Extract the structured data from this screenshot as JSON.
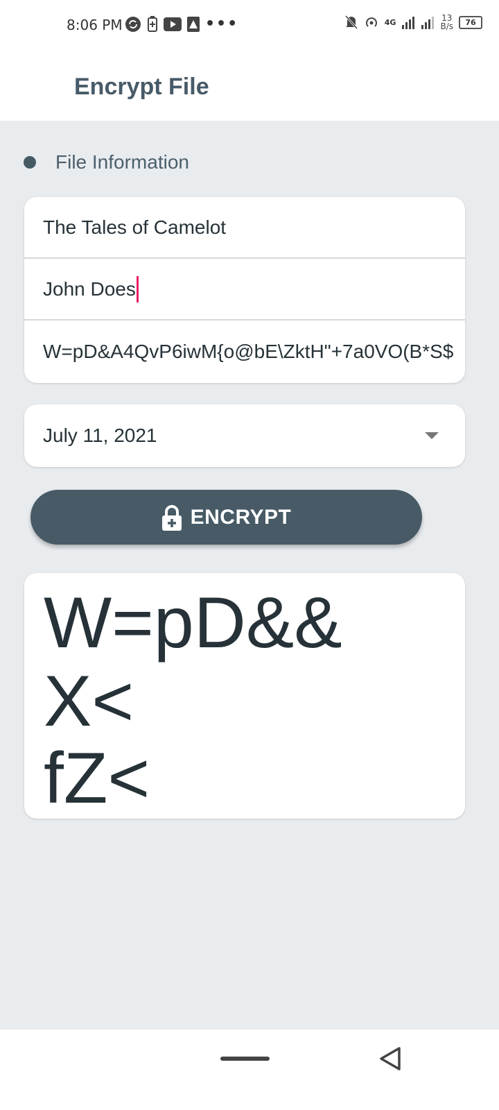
{
  "status_bar": {
    "time": "8:06 PM",
    "speed_value": "13",
    "speed_unit": "B/s",
    "battery": "76",
    "network": "4G"
  },
  "app_bar": {
    "title": "Encrypt File"
  },
  "section": {
    "label": "File Information"
  },
  "fields": {
    "title_value": "The Tales of Camelot",
    "author_value": "John Does",
    "key_value": "W=pD&A4QvP6iwM{o@bE\\ZktH\"+7a0VO(B*S$"
  },
  "date": {
    "value": "July 11, 2021"
  },
  "encrypt_button": {
    "label": "ENCRYPT",
    "icon": "lock-icon"
  },
  "output": {
    "lines": [
      "W=pD&&",
      "X<",
      "fZ<"
    ]
  },
  "colors": {
    "accent": "#475a66",
    "cursor": "#e91e63",
    "background": "#e9ecef"
  }
}
